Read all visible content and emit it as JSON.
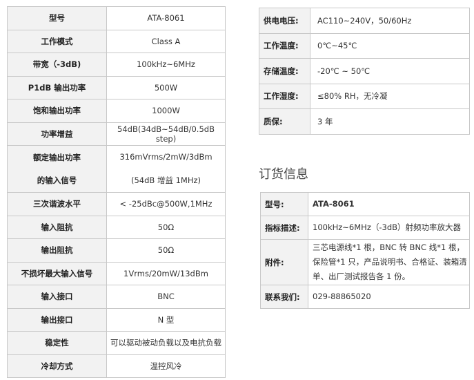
{
  "spec_table": {
    "rows": [
      {
        "label": "型号",
        "value": "ATA-8061"
      },
      {
        "label": "工作模式",
        "value": "Class A"
      },
      {
        "label": "带宽（-3dB)",
        "value": "100kHz~6MHz"
      },
      {
        "label": "P1dB 输出功率",
        "value": "500W"
      },
      {
        "label": "饱和输出功率",
        "value": "1000W"
      },
      {
        "label": "功率增益",
        "value": "54dB(34dB~54dB/0.5dB step)"
      },
      {
        "label_line1": "额定输出功率",
        "label_line2": "的输入信号",
        "value_line1": "316mVrms/2mW/3dBm",
        "value_line2": "(54dB 增益 1MHz)"
      },
      {
        "label": "三次谐波水平",
        "value": "< -25dBc@500W,1MHz"
      },
      {
        "label": "输入阻抗",
        "value": "50Ω"
      },
      {
        "label": "输出阻抗",
        "value": "50Ω"
      },
      {
        "label": "不损坏最大输入信号",
        "value": "1Vrms/20mW/13dBm"
      },
      {
        "label": "输入接口",
        "value": "BNC"
      },
      {
        "label": "输出接口",
        "value": "N 型"
      },
      {
        "label": "稳定性",
        "value": "可以驱动被动负载以及电抗负载"
      },
      {
        "label": "冷却方式",
        "value": "温控风冷"
      }
    ]
  },
  "env_table": {
    "rows": [
      {
        "label": "供电电压:",
        "value": "AC110~240V，50/60Hz"
      },
      {
        "label": "工作温度:",
        "value": "0℃~45℃"
      },
      {
        "label": "存储温度:",
        "value": "-20℃ ~ 50℃"
      },
      {
        "label": "工作湿度:",
        "value": "≤80% RH，无冷凝"
      },
      {
        "label": "质保:",
        "value": "3  年"
      }
    ]
  },
  "order_section": {
    "title": "订货信息",
    "rows": [
      {
        "label": "型号:",
        "value": "ATA-8061"
      },
      {
        "label": "指标描述:",
        "value": "100kHz~6MHz（-3dB）射频功率放大器"
      },
      {
        "label": "附件:",
        "value": "三芯电源线*1 根，BNC 转 BNC 线*1 根，保险管*1 只，产品说明书、合格证、装箱清单、出厂测试报告各 1 份。"
      },
      {
        "label": "联系我们:",
        "value": "029-88865020"
      }
    ]
  }
}
